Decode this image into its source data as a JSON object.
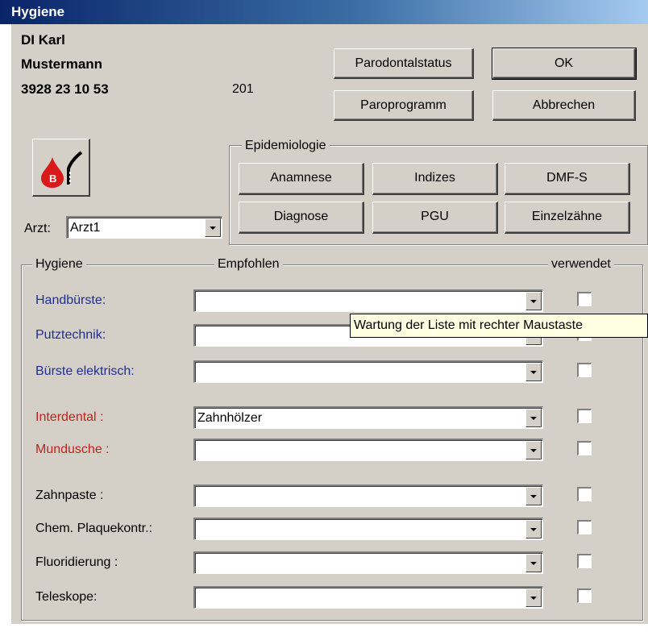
{
  "window": {
    "title": "Hygiene"
  },
  "patient": {
    "first_line": "DI Karl",
    "last_name": "Mustermann",
    "phone": "3928 23 10 53",
    "code": "201"
  },
  "top_buttons": {
    "parodontalstatus": "Parodontalstatus",
    "paroprogramm": "Paroprogramm",
    "ok": "OK",
    "abbrechen": "Abbrechen"
  },
  "epidemiologie": {
    "legend": "Epidemiologie",
    "buttons": [
      "Anamnese",
      "Indizes",
      "DMF-S",
      "Diagnose",
      "PGU",
      "Einzelzähne"
    ]
  },
  "arzt": {
    "label": "Arzt:",
    "value": "Arzt1"
  },
  "hygiene": {
    "col_hygiene": "Hygiene",
    "col_empfohlen": "Empfohlen",
    "col_verwendet": "verwendet",
    "rows": [
      {
        "label": "Handbürste:",
        "value": "",
        "color": "#1f2f8f"
      },
      {
        "label": "Putztechnik:",
        "value": "",
        "color": "#1f2f8f"
      },
      {
        "label": "Bürste elektrisch:",
        "value": "",
        "color": "#1f2f8f"
      },
      {
        "label": "Interdental :",
        "value": "Zahnhölzer",
        "color": "#c0221c"
      },
      {
        "label": "Mundusche :",
        "value": "",
        "color": "#c0221c"
      },
      {
        "label": "Zahnpaste :",
        "value": "",
        "color": "#000000"
      },
      {
        "label": "Chem. Plaquekontr.:",
        "value": "",
        "color": "#000000"
      },
      {
        "label": "Fluoridierung :",
        "value": "",
        "color": "#000000"
      },
      {
        "label": "Teleskope:",
        "value": "",
        "color": "#000000"
      }
    ]
  },
  "tooltip": "Wartung der Liste mit rechter Maustaste",
  "icon": {
    "name": "blood-b-icon",
    "letter": "B"
  }
}
